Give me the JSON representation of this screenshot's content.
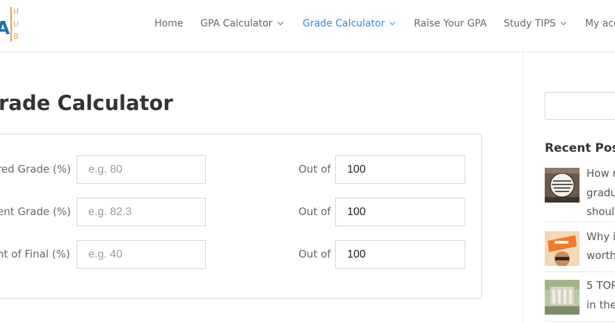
{
  "logo": {
    "letter_a": "A",
    "letter_h": "H",
    "letter_u": "U",
    "letter_b": "B"
  },
  "nav": {
    "items": [
      {
        "label": "Home",
        "dropdown": false
      },
      {
        "label": "GPA Calculator",
        "dropdown": true
      },
      {
        "label": "Grade Calculator",
        "dropdown": true,
        "active": true
      },
      {
        "label": "Raise Your GPA",
        "dropdown": false
      },
      {
        "label": "Study TIPS",
        "dropdown": true
      },
      {
        "label": "My acc",
        "dropdown": false
      }
    ]
  },
  "page": {
    "title": "rade Calculator"
  },
  "calculator": {
    "rows": [
      {
        "label": "red Grade (%)",
        "placeholder": "e.g. 80",
        "out_label": "Out of",
        "out_value": "100"
      },
      {
        "label": "ent Grade (%)",
        "placeholder": "e.g. 82.3",
        "out_label": "Out of",
        "out_value": "100"
      },
      {
        "label": "ht of Final (%)",
        "placeholder": "e.g. 40",
        "out_label": "Out of",
        "out_value": "100"
      }
    ]
  },
  "sidebar": {
    "recent_title": "Recent Posts",
    "posts": [
      {
        "lines": [
          "How n",
          "gradu",
          "shoul"
        ],
        "thumb_text": "Tips for Applying to Grad School"
      },
      {
        "lines": [
          "Why i",
          "worth"
        ],
        "thumb_text": "Chegg"
      },
      {
        "lines": [
          "5 TOP",
          "in the"
        ],
        "thumb_text": ""
      }
    ]
  },
  "colors": {
    "accent": "#2e8ad8",
    "logo_blue": "#1f6fb5",
    "logo_orange": "#e8a33c"
  }
}
